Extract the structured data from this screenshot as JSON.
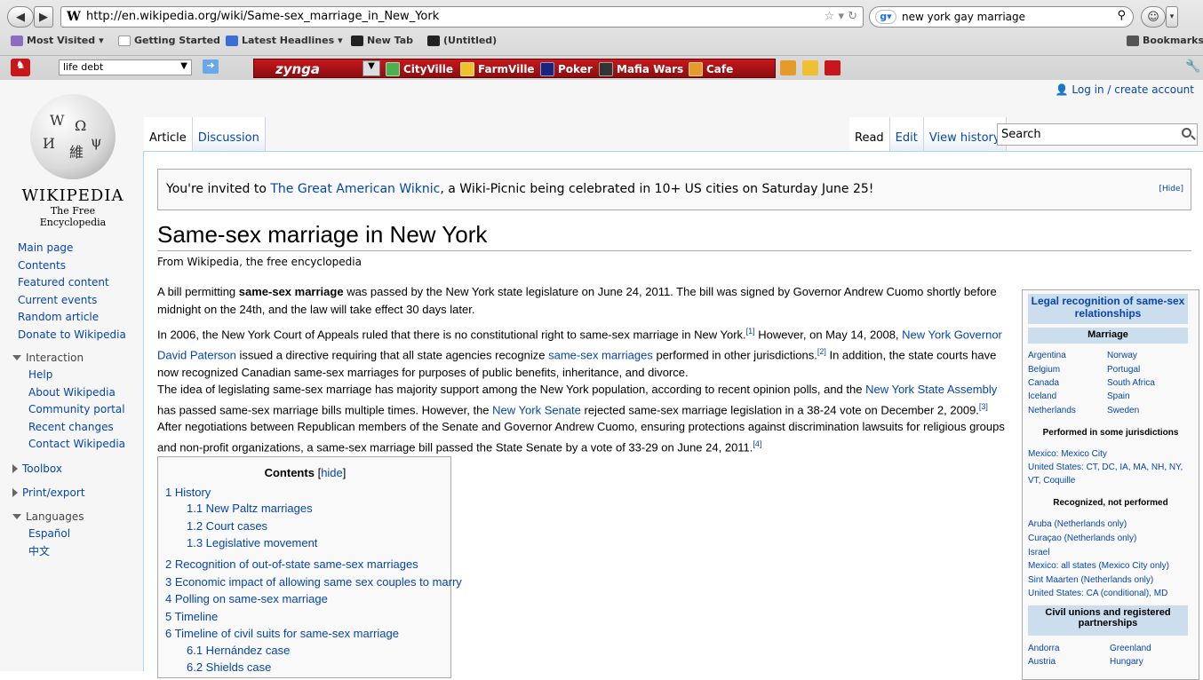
{
  "browser": {
    "url": "http://en.wikipedia.org/wiki/Same-sex_marriage_in_New_York",
    "search_query": "new york gay marriage",
    "bookmarks": [
      "Most Visited",
      "Getting Started",
      "Latest Headlines",
      "New Tab",
      "(Untitled)"
    ],
    "bookmarks_right": "Bookmarks",
    "toolbar_field": "life debt",
    "zynga_label": "zynga",
    "zynga_games": [
      "CityVille",
      "FarmVille",
      "Poker",
      "Mafia Wars",
      "Cafe"
    ]
  },
  "wiki": {
    "login": "Log in / create account",
    "logo_title": "WIKIPEDIA",
    "logo_sub": "The Free Encyclopedia",
    "nav": [
      "Main page",
      "Contents",
      "Featured content",
      "Current events",
      "Random article",
      "Donate to Wikipedia"
    ],
    "interaction_title": "Interaction",
    "interaction": [
      "Help",
      "About Wikipedia",
      "Community portal",
      "Recent changes",
      "Contact Wikipedia"
    ],
    "toolbox": "Toolbox",
    "print": "Print/export",
    "languages_title": "Languages",
    "languages": [
      "Español",
      "中文"
    ],
    "tabs_left": [
      "Article",
      "Discussion"
    ],
    "tabs_right": [
      "Read",
      "Edit",
      "View history"
    ],
    "search_placeholder": "Search"
  },
  "notice": {
    "prefix": "You're invited to ",
    "link": "The Great American Wiknic",
    "suffix": ", a Wiki-Picnic being celebrated in 10+ US cities on Saturday June 25!",
    "hide": "[Hide]"
  },
  "article": {
    "title": "Same-sex marriage in New York",
    "from": "From Wikipedia, the free encyclopedia",
    "p1a": "A bill permitting ",
    "p1b": "same-sex marriage",
    "p1c": " was passed by the New York state legislature on June 24, 2011. The bill was signed by Governor Andrew Cuomo shortly before midnight on the 24th, and the law will take effect 30 days later.",
    "p2a": "In 2006, the New York Court of Appeals ruled that there is no constitutional right to same-sex marriage in New York.",
    "p2b": " However, on May 14, 2008, ",
    "p2c": "New York Governor David Paterson",
    "p2d": " issued a directive requiring that all state agencies recognize ",
    "p2e": "same-sex marriages",
    "p2f": " performed in other jurisdictions.",
    "p2g": " In addition, the state courts have now recognized Canadian same-sex marriages for purposes of public benefits, inheritance, and divorce.",
    "p3a": "The idea of legislating same-sex marriage has majority support among the New York population, according to recent opinion polls, and the ",
    "p3b": "New York State Assembly",
    "p3c": " has passed same-sex marriage bills multiple times. However, the ",
    "p3d": "New York Senate",
    "p3e": " rejected same-sex marriage legislation in a 38-24 vote on December 2, 2009.",
    "p3f": " After negotiations between Republican members of the Senate and Governor Andrew Cuomo, ensuring protections against discrimination lawsuits for religious groups and non-profit organizations, a same-sex marriage bill passed the State Senate by a vote of 33-29 on June 24, 2011.",
    "refs": [
      "[1]",
      "[2]",
      "[3]",
      "[4]"
    ]
  },
  "toc": {
    "title": "Contents",
    "hide": "hide",
    "items": [
      "1 History",
      "1.1 New Paltz marriages",
      "1.2 Court cases",
      "1.3 Legislative movement",
      "2 Recognition of out-of-state same-sex marriages",
      "3 Economic impact of allowing same sex couples to marry",
      "4 Polling on same-sex marriage",
      "5 Timeline",
      "6 Timeline of civil suits for same-sex marriage",
      "6.1 Hernández case",
      "6.2 Shields case"
    ]
  },
  "infobox": {
    "title": "Legal recognition of same-sex relationships",
    "marriage": "Marriage",
    "countries_left": [
      "Argentina",
      "Belgium",
      "Canada",
      "Iceland",
      "Netherlands"
    ],
    "countries_right": [
      "Norway",
      "Portugal",
      "South Africa",
      "Spain",
      "Sweden"
    ],
    "some_title": "Performed in some jurisdictions",
    "some1": "Mexico: Mexico City",
    "some2": "United States: CT, DC, IA, MA, NH, NY,",
    "some3": "VT, Coquille",
    "recog_title": "Recognized, not performed",
    "recog": [
      "Aruba (Netherlands only)",
      "Curaçao (Netherlands only)",
      "Israel",
      "Mexico: all states (Mexico City only)",
      "Sint Maarten (Netherlands only)",
      "United States: CA (conditional), MD"
    ],
    "civil_title": "Civil unions and registered partnerships",
    "civil_left": [
      "Andorra",
      "Austria"
    ],
    "civil_right": [
      "Greenland",
      "Hungary"
    ]
  },
  "colors": {
    "link": "#0645ad",
    "zynga": "#c8171c"
  }
}
